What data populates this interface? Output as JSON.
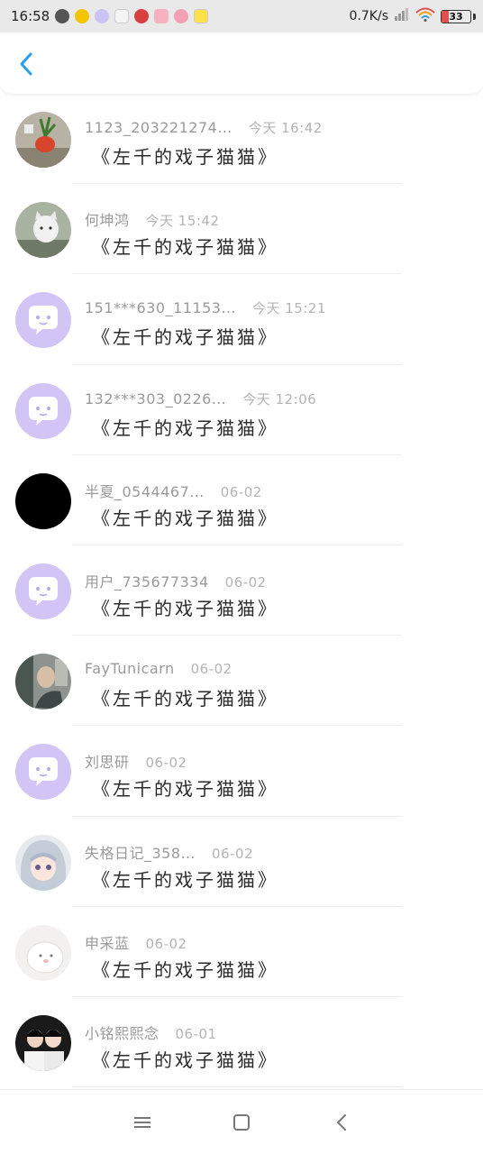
{
  "status_bar": {
    "time": "16:58",
    "net_speed": "0.7K/s",
    "battery": "33",
    "colors": {
      "battery_low": "#e05050"
    }
  },
  "header": {
    "back_icon": "chevron-left-icon",
    "accent": "#2a9df4"
  },
  "messages": [
    {
      "name": "1123_203221274…",
      "time": "今天 16:42",
      "text": "《左千的戏子猫猫》",
      "avatar": "photo-plant"
    },
    {
      "name": "何坤鸿",
      "time": "今天 15:42",
      "text": "《左千的戏子猫猫》",
      "avatar": "photo-cat"
    },
    {
      "name": "151***630_11153…",
      "time": "今天 15:21",
      "text": "《左千的戏子猫猫》",
      "avatar": "default-chat"
    },
    {
      "name": "132***303_0226…",
      "time": "今天 12:06",
      "text": "《左千的戏子猫猫》",
      "avatar": "default-chat"
    },
    {
      "name": "半夏_0544467…",
      "time": "06-02",
      "text": "《左千的戏子猫猫》",
      "avatar": "black"
    },
    {
      "name": "用户_735677334",
      "time": "06-02",
      "text": "《左千的戏子猫猫》",
      "avatar": "default-chat"
    },
    {
      "name": "FayTunicarn",
      "time": "06-02",
      "text": "《左千的戏子猫猫》",
      "avatar": "photo-people"
    },
    {
      "name": "刘思研",
      "time": "06-02",
      "text": "《左千的戏子猫猫》",
      "avatar": "default-chat"
    },
    {
      "name": "失格日记_358…",
      "time": "06-02",
      "text": "《左千的戏子猫猫》",
      "avatar": "photo-anime"
    },
    {
      "name": "申采蓝",
      "time": "06-02",
      "text": "《左千的戏子猫猫》",
      "avatar": "photo-white-cat"
    },
    {
      "name": "小铭熙熙念",
      "time": "06-01",
      "text": "《左千的戏子猫猫》",
      "avatar": "photo-couple"
    }
  ],
  "nav_bar": {
    "icons": [
      "menu-icon",
      "home-square-icon",
      "back-triangle-icon"
    ]
  }
}
